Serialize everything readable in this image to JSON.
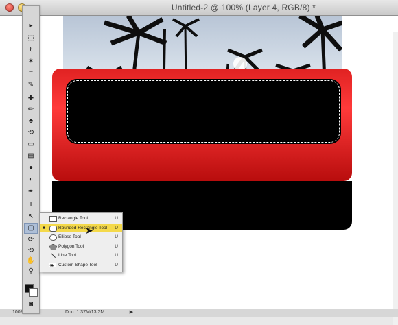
{
  "window": {
    "title": "Untitled-2 @ 100% (Layer 4, RGB/8) *"
  },
  "status": {
    "zoom": "100%",
    "doc_info": "Doc: 1.37M/13.2M",
    "arrow": "▶"
  },
  "tools": [
    {
      "name": "move-tool",
      "icon": "▸"
    },
    {
      "name": "marquee-tool",
      "icon": "⬚"
    },
    {
      "name": "lasso-tool",
      "icon": "ℓ"
    },
    {
      "name": "magic-wand-tool",
      "icon": "✶"
    },
    {
      "name": "crop-tool",
      "icon": "⌗"
    },
    {
      "name": "eyedropper-tool",
      "icon": "✎"
    },
    {
      "name": "healing-tool",
      "icon": "✚"
    },
    {
      "name": "brush-tool",
      "icon": "✏"
    },
    {
      "name": "stamp-tool",
      "icon": "♣"
    },
    {
      "name": "history-brush-tool",
      "icon": "⟲"
    },
    {
      "name": "eraser-tool",
      "icon": "▭"
    },
    {
      "name": "gradient-tool",
      "icon": "▤"
    },
    {
      "name": "blur-tool",
      "icon": "●"
    },
    {
      "name": "dodge-tool",
      "icon": "◐"
    },
    {
      "name": "pen-tool",
      "icon": "✒"
    },
    {
      "name": "type-tool",
      "icon": "T"
    },
    {
      "name": "path-select-tool",
      "icon": "↖"
    },
    {
      "name": "shape-tool",
      "icon": "▢"
    },
    {
      "name": "3d-tool",
      "icon": "⟳"
    },
    {
      "name": "3d-camera-tool",
      "icon": "⟲"
    },
    {
      "name": "hand-tool",
      "icon": "✋"
    },
    {
      "name": "zoom-tool",
      "icon": "⚲"
    }
  ],
  "flyout": {
    "items": [
      {
        "label": "Rectangle Tool",
        "key": "U",
        "selected": false,
        "current": false
      },
      {
        "label": "Rounded Rectangle Tool",
        "key": "U",
        "selected": true,
        "current": true
      },
      {
        "label": "Ellipse Tool",
        "key": "U",
        "selected": false,
        "current": false
      },
      {
        "label": "Polygon Tool",
        "key": "U",
        "selected": false,
        "current": false
      },
      {
        "label": "Line Tool",
        "key": "U",
        "selected": false,
        "current": false
      },
      {
        "label": "Custom Shape Tool",
        "key": "U",
        "selected": false,
        "current": false
      }
    ]
  }
}
